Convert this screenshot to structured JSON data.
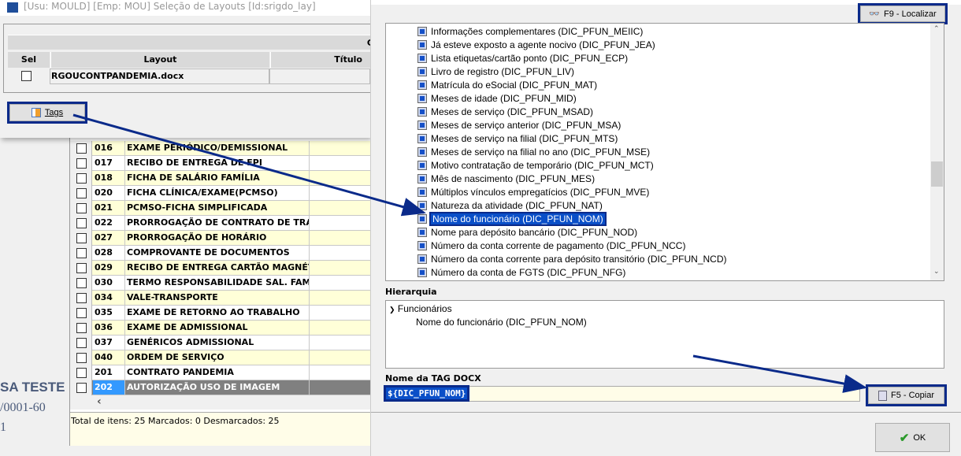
{
  "background": {
    "lines": [
      "SA TESTE",
      "/0001-60",
      "1"
    ]
  },
  "top_dialog": {
    "title": "[Usu: MOULD] [Emp: MOU] Seleção de Layouts [Id:srigdo_lay]",
    "group_header": "C",
    "columns": [
      "Sel",
      "Layout",
      "Título"
    ],
    "rows": [
      {
        "layout": "RGOUCONTPANDEMIA.docx",
        "titulo": ""
      }
    ],
    "tags_button": "Tags"
  },
  "grid": {
    "rows": [
      {
        "code": "016",
        "name": "EXAME PERIÓDICO/DEMISSIONAL"
      },
      {
        "code": "017",
        "name": "RECIBO DE ENTREGA DE EPI"
      },
      {
        "code": "018",
        "name": "FICHA DE SALÁRIO FAMÍLIA"
      },
      {
        "code": "020",
        "name": "FICHA CLÍNICA/EXAME(PCMSO)"
      },
      {
        "code": "021",
        "name": "PCMSO-FICHA SIMPLIFICADA"
      },
      {
        "code": "022",
        "name": "PRORROGAÇÃO DE CONTRATO DE TRABA"
      },
      {
        "code": "027",
        "name": "PRORROGAÇÃO DE HORÁRIO"
      },
      {
        "code": "028",
        "name": "COMPROVANTE DE DOCUMENTOS"
      },
      {
        "code": "029",
        "name": "RECIBO DE ENTREGA CARTÃO MAGNÉTI"
      },
      {
        "code": "030",
        "name": "TERMO RESPONSABILIDADE SAL. FAMÍ"
      },
      {
        "code": "034",
        "name": "VALE-TRANSPORTE"
      },
      {
        "code": "035",
        "name": "EXAME DE RETORNO AO TRABALHO"
      },
      {
        "code": "036",
        "name": "EXAME DE ADMISSIONAL"
      },
      {
        "code": "037",
        "name": "GENÉRICOS ADMISSIONAL"
      },
      {
        "code": "040",
        "name": "ORDEM DE SERVIÇO"
      },
      {
        "code": "201",
        "name": "CONTRATO PANDEMIA"
      },
      {
        "code": "202",
        "name": "AUTORIZAÇÃO USO DE IMAGEM",
        "selected": true
      }
    ],
    "scroll_left": "‹",
    "status": "Total de itens: 25 Marcados: 0 Desmarcados: 25"
  },
  "tags_dialog": {
    "find_button": "F9 - Localizar",
    "tree_items": [
      "Informações complementares (DIC_PFUN_MEIIC)",
      "Já esteve exposto a agente nocivo (DIC_PFUN_JEA)",
      "Lista etiquetas/cartão ponto (DIC_PFUN_ECP)",
      "Livro de registro (DIC_PFUN_LIV)",
      "Matrícula do eSocial (DIC_PFUN_MAT)",
      "Meses de idade (DIC_PFUN_MID)",
      "Meses de serviço (DIC_PFUN_MSAD)",
      "Meses de serviço anterior (DIC_PFUN_MSA)",
      "Meses de serviço na filial (DIC_PFUN_MTS)",
      "Meses de serviço na filial no ano (DIC_PFUN_MSE)",
      "Motivo contratação de temporário (DIC_PFUN_MCT)",
      "Mês de nascimento (DIC_PFUN_MES)",
      "Múltiplos vínculos empregatícios (DIC_PFUN_MVE)",
      "Natureza da atividade (DIC_PFUN_NAT)",
      "Nome do funcionário (DIC_PFUN_NOM)",
      "Nome para depósito bancário (DIC_PFUN_NOD)",
      "Número da conta corrente de pagamento (DIC_PFUN_NCC)",
      "Número da conta corrente para depósito transitório (DIC_PFUN_NCD)",
      "Número da conta de FGTS (DIC_PFUN_NFG)"
    ],
    "selected_index": 14,
    "hierarchy_label": "Hierarquia",
    "hierarchy": {
      "parent": "Funcionários",
      "child": "Nome do funcionário (DIC_PFUN_NOM)"
    },
    "tag_label": "Nome da TAG DOCX",
    "tag_value": "${DIC_PFUN_NOM}",
    "copy_button": "F5 - Copiar",
    "ok_button": "OK"
  },
  "colors": {
    "highlight": "#0a2a8a",
    "selection": "#0a4fc8",
    "row_alt": "#ffffd8"
  }
}
